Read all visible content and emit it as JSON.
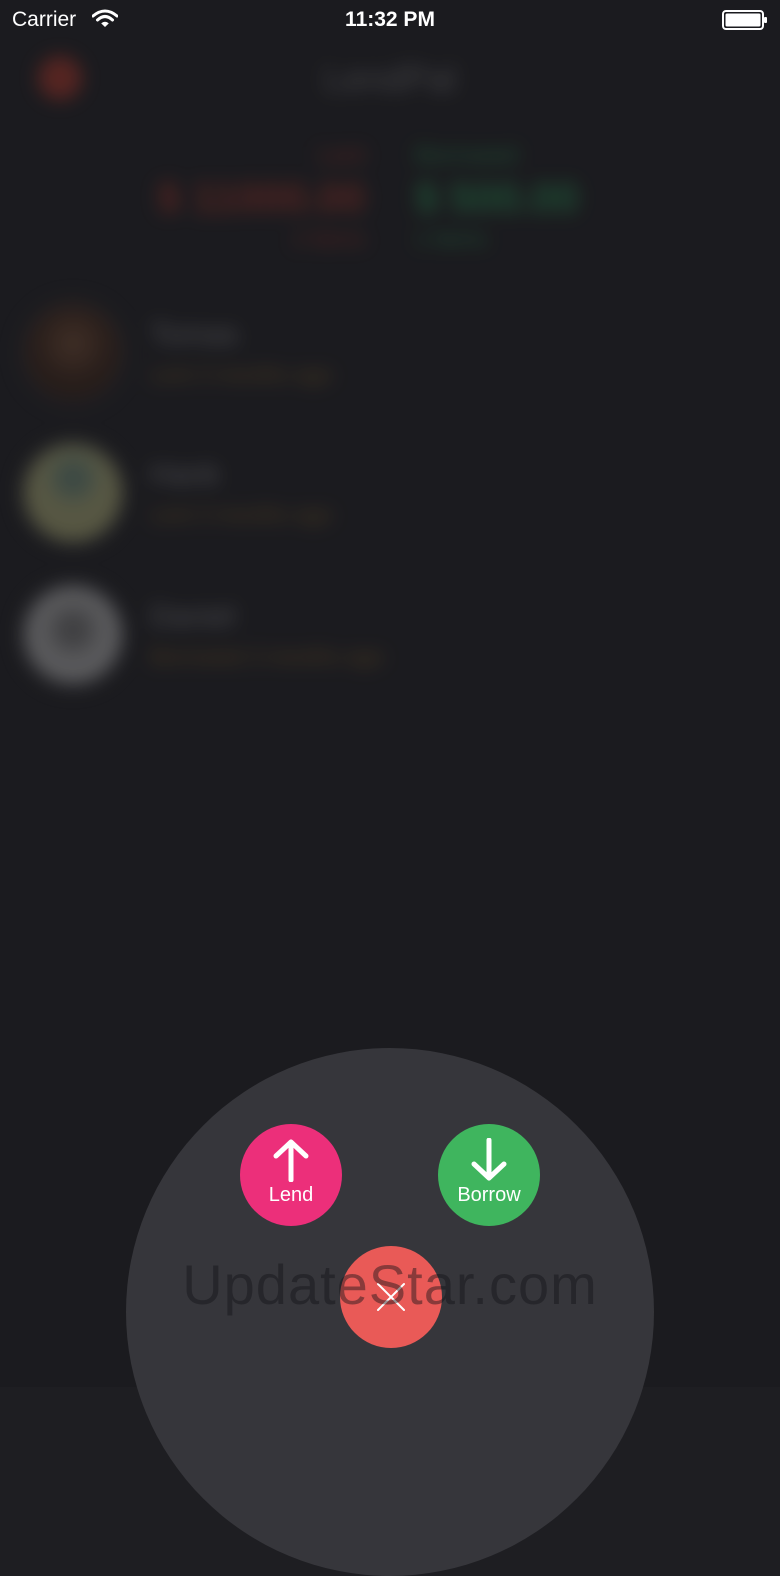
{
  "status_bar": {
    "carrier": "Carrier",
    "time": "11:32 PM",
    "wifi_icon": "wifi-icon",
    "battery_icon": "battery-full-icon"
  },
  "background_app": {
    "title": "LendPal",
    "menu_icon": "menu-icon",
    "summary": {
      "lent_label": "Lent",
      "lent_amount": "$ 11000.00",
      "lent_count": "2 Items",
      "borrowed_label": "Borrowed",
      "borrowed_amount": "$ 500.00",
      "borrowed_count": "1 Items"
    },
    "contacts": [
      {
        "name": "Tomas",
        "detail": "Lent 3 months ago"
      },
      {
        "name": "Hank",
        "detail": "Lent 3 months ago"
      },
      {
        "name": "Daniel",
        "detail": "Borrowed 3 months ago"
      }
    ]
  },
  "action_menu": {
    "lend_label": "Lend",
    "borrow_label": "Borrow",
    "lend_icon": "arrow-up-icon",
    "borrow_icon": "arrow-down-icon",
    "close_icon": "close-icon",
    "colors": {
      "lend": "#ec2f7a",
      "borrow": "#3fb55e",
      "close": "#e95a57",
      "panel": "#36363b"
    }
  },
  "watermark": "UpdateStar.com"
}
